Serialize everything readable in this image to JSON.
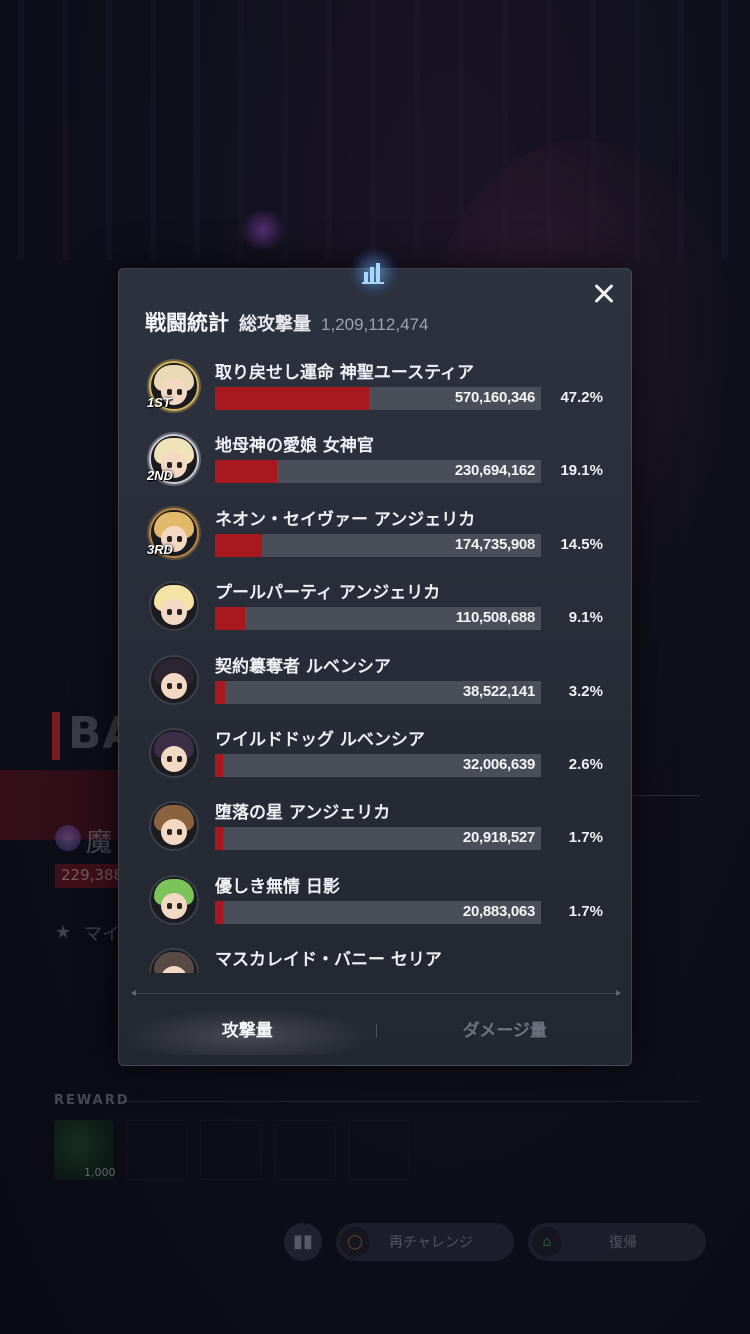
{
  "background": {
    "bat_text": "BAT",
    "mage_text": "魔",
    "score": "229,388",
    "my_text": "マイ",
    "reward_label": "REWARD",
    "reward_count": "1,000",
    "retry_label": "再チャレンジ",
    "return_label": "復帰"
  },
  "modal": {
    "title": "戦闘統計",
    "total_label": "総攻撃量",
    "total_value": "1,209,112,474",
    "close_icon": "close-icon",
    "tabs": {
      "attack": "攻撃量",
      "damage": "ダメージ量",
      "active": "attack"
    },
    "rows": [
      {
        "name": "取り戻せし運命 神聖ユースティア",
        "value": "570,160,346",
        "percent": "47.2%",
        "fill": 0.472,
        "rank": "1ST",
        "frame": "gold",
        "hair": "#e9d9b5"
      },
      {
        "name": "地母神の愛娘 女神官",
        "value": "230,694,162",
        "percent": "19.1%",
        "fill": 0.191,
        "rank": "2ND",
        "frame": "silver",
        "hair": "#f1e3b8"
      },
      {
        "name": "ネオン・セイヴァー アンジェリカ",
        "value": "174,735,908",
        "percent": "14.5%",
        "fill": 0.145,
        "rank": "3RD",
        "frame": "bronze",
        "hair": "#e2b86a"
      },
      {
        "name": "プールパーティ アンジェリカ",
        "value": "110,508,688",
        "percent": "9.1%",
        "fill": 0.091,
        "rank": "",
        "frame": "none",
        "hair": "#f5e3a6"
      },
      {
        "name": "契約簒奪者 ルベンシア",
        "value": "38,522,141",
        "percent": "3.2%",
        "fill": 0.032,
        "rank": "",
        "frame": "none",
        "hair": "#2a2530"
      },
      {
        "name": "ワイルドドッグ ルベンシア",
        "value": "32,006,639",
        "percent": "2.6%",
        "fill": 0.026,
        "rank": "",
        "frame": "none",
        "hair": "#3b2f48"
      },
      {
        "name": "堕落の星 アンジェリカ",
        "value": "20,918,527",
        "percent": "1.7%",
        "fill": 0.017,
        "rank": "",
        "frame": "none",
        "hair": "#8a6240"
      },
      {
        "name": "優しき無情 日影",
        "value": "20,883,063",
        "percent": "1.7%",
        "fill": 0.017,
        "rank": "",
        "frame": "none",
        "hair": "#7cc45a"
      },
      {
        "name": "マスカレイド・バニー セリア",
        "value": "",
        "percent": "",
        "fill": 0,
        "rank": "",
        "frame": "none",
        "hair": "#5a4a45"
      }
    ]
  },
  "colors": {
    "bar_fill": "#a8181e",
    "bar_track": "#4a4e59",
    "panel": "#2b303c"
  }
}
